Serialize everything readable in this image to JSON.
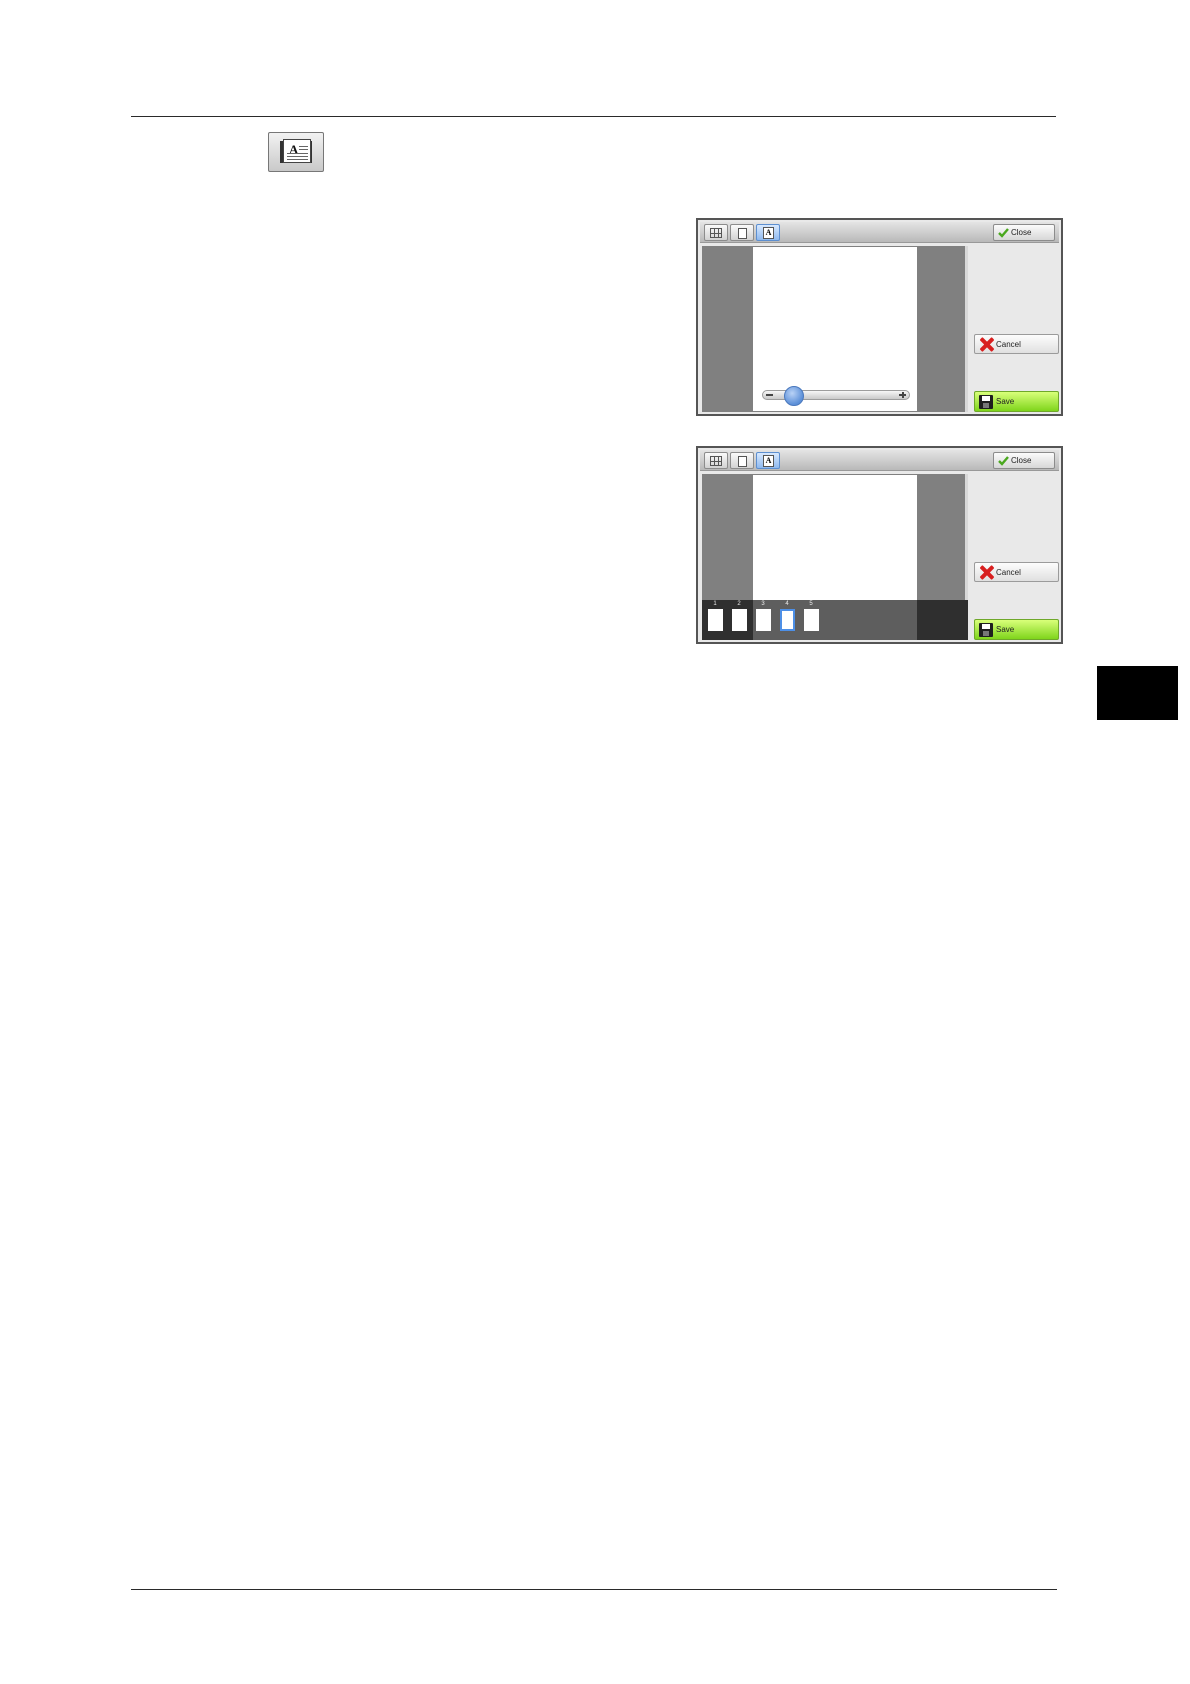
{
  "icon_button": {
    "icon": "document-text-icon",
    "glyph": "A"
  },
  "panels": [
    {
      "toolbar": {
        "tools": [
          "grid-view-icon",
          "page-view-icon",
          "text-view-icon"
        ],
        "active_tool": "text-view-icon",
        "close_label": "Close"
      },
      "view": "zoom-slider",
      "zoom_level": 0.12,
      "cancel_label": "Cancel",
      "save_label": "Save"
    },
    {
      "toolbar": {
        "tools": [
          "grid-view-icon",
          "page-view-icon",
          "text-view-icon"
        ],
        "active_tool": "text-view-icon",
        "close_label": "Close"
      },
      "view": "page-strip",
      "pages": [
        "1",
        "2",
        "3",
        "4",
        "5"
      ],
      "selected_page": "4",
      "cancel_label": "Cancel",
      "save_label": "Save"
    }
  ],
  "colors": {
    "save_green": "#8fdc2a",
    "cancel_red": "#d81f1f",
    "selection_blue": "#4d8fe6"
  }
}
